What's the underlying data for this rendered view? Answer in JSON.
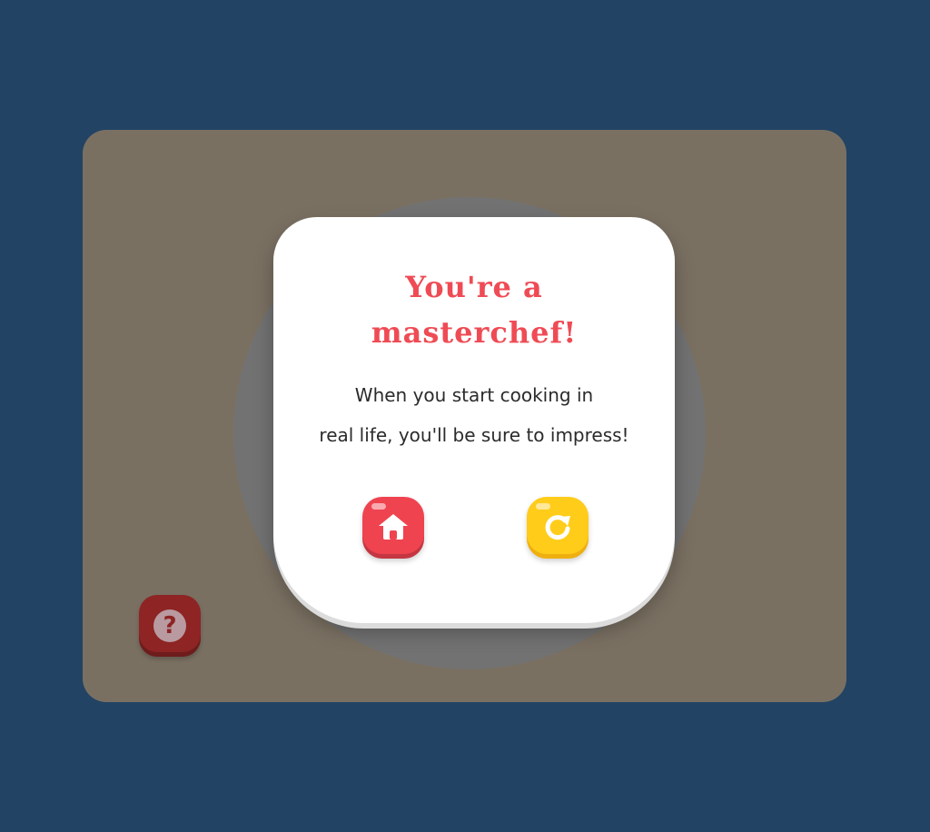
{
  "dialog": {
    "title_lines": [
      "You're a",
      "masterchef!"
    ],
    "message_lines": [
      "When you start cooking in",
      "real life, you'll be sure to impress!"
    ]
  },
  "buttons": {
    "home_icon": "home-icon",
    "replay_icon": "replay-icon",
    "help_icon": "question-mark-icon",
    "help_glyph": "?"
  },
  "colors": {
    "background": "#224364",
    "title": "#ef4b55",
    "home_button": "#ef4350",
    "replay_button": "#ffcc1a",
    "help_button": "#8e2424"
  }
}
